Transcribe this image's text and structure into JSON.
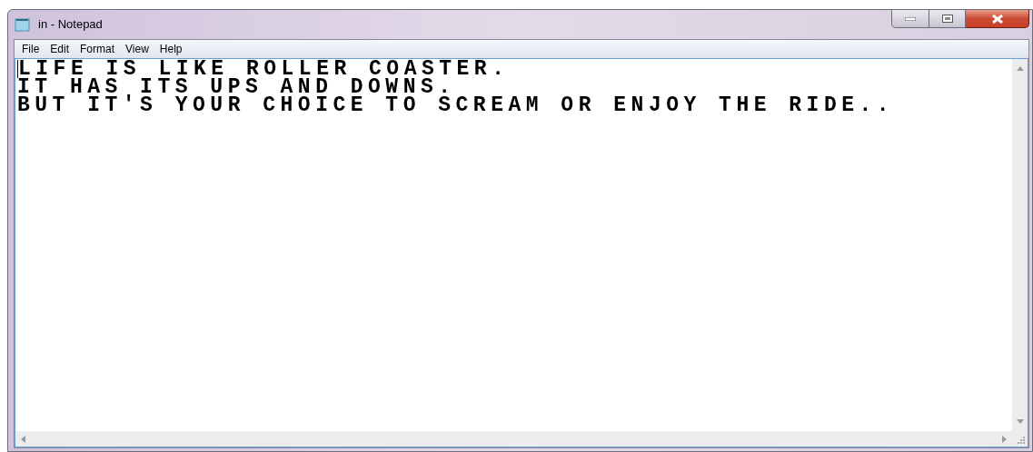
{
  "window": {
    "title": "in - Notepad"
  },
  "menu": [
    "File",
    "Edit",
    "Format",
    "View",
    "Help"
  ],
  "document": {
    "lines": [
      "LIFE IS LIKE ROLLER COASTER.",
      "IT HAS ITS UPS AND DOWNS.",
      "BUT IT'S YOUR CHOICE TO SCREAM OR ENJOY THE RIDE.."
    ]
  }
}
